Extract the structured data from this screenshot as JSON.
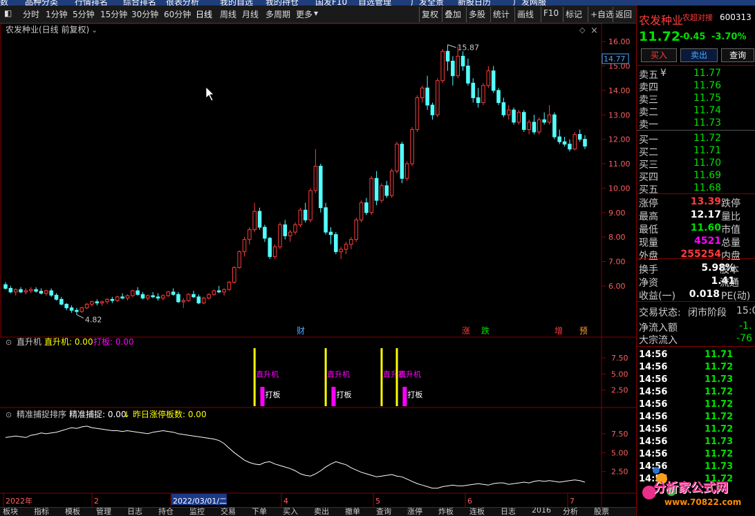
{
  "top_menu": [
    "数",
    "品种分类",
    "行情排名",
    "综合排名",
    "很表分析",
    "我的自选",
    "我的持仓",
    "国发F10",
    "自选管理",
    "广发全景",
    "新股日历",
    "广发网服"
  ],
  "toolbar": {
    "items": [
      "分时",
      "1分钟",
      "5分钟",
      "15分钟",
      "30分钟",
      "60分钟",
      "日线",
      "周线",
      "月线",
      "多周期",
      "更多"
    ],
    "active": "日线",
    "right_items": [
      "复权",
      "叠加",
      "多股",
      "统计",
      "画线",
      "F10",
      "标记",
      "+自选",
      "返回"
    ]
  },
  "main_chart": {
    "title": "农发种业(日线 前复权)",
    "y_ticks": [
      "16.00",
      "15.00",
      "14.00",
      "13.00",
      "12.00",
      "11.00",
      "10.00",
      "9.00",
      "8.00",
      "7.00",
      "6.00"
    ],
    "cursor_price": "14.77",
    "high_label": "15.87",
    "low_label": "4.82",
    "markers": [
      {
        "text": "财",
        "color": "#4aa8ff"
      },
      {
        "text": "涨",
        "color": "#ff3c3c"
      },
      {
        "text": "跌",
        "color": "#00e000"
      },
      {
        "text": "增",
        "color": "#ff3c3c"
      },
      {
        "text": "预",
        "color": "#ff9a3c"
      }
    ]
  },
  "indicator1": {
    "name": "直升机",
    "legend_a": "直升机: 0.00",
    "legend_b": "打板: 0.00",
    "y_ticks": [
      "7.50",
      "5.00",
      "2.50"
    ],
    "signal_a": "直升机",
    "signal_b": "打板"
  },
  "indicator2": {
    "name": "精准捕捉排序",
    "legend_a": "精准捕捉: 0.00",
    "arrow": "↓",
    "legend_b": "昨日涨停板数: 0.00",
    "y_ticks": [
      "7.50",
      "5.00",
      "2.50"
    ]
  },
  "time_axis": {
    "labels": [
      "2022年",
      "2",
      "2022/03/01/二",
      "4",
      "5",
      "6",
      "7"
    ]
  },
  "bottom_bar": [
    "板块",
    "指标",
    "模板",
    "管理",
    "日志",
    "持仓",
    "监控",
    "交易",
    "下单",
    "买入",
    "卖出",
    "撤单",
    "查询",
    "涨停",
    "炸板",
    "连板",
    "日志",
    "2016",
    "分析",
    "股票"
  ],
  "right_panel": {
    "stock_name": "农发种业",
    "super_label": "农超对接",
    "code": "600313",
    "price": "11.72",
    "change": "-0.45",
    "pct": "-3.70%",
    "buttons": {
      "buy": "买入",
      "sell": "卖出",
      "query": "查询"
    },
    "asks": [
      {
        "label": "卖五",
        "price": "11.77"
      },
      {
        "label": "卖四",
        "price": "11.76"
      },
      {
        "label": "卖三",
        "price": "11.75"
      },
      {
        "label": "卖二",
        "price": "11.74"
      },
      {
        "label": "卖一",
        "price": "11.73"
      }
    ],
    "ask5_mark": "¥",
    "bids": [
      {
        "label": "买一",
        "price": "11.72"
      },
      {
        "label": "买二",
        "price": "11.71"
      },
      {
        "label": "买三",
        "price": "11.70"
      },
      {
        "label": "买四",
        "price": "11.69"
      },
      {
        "label": "买五",
        "price": "11.68"
      }
    ],
    "stats": [
      {
        "label": "涨停",
        "value": "13.39",
        "color": "red",
        "label2": "跌停"
      },
      {
        "label": "最高",
        "value": "12.17",
        "color": "white",
        "label2": "量比"
      },
      {
        "label": "最低",
        "value": "11.60",
        "color": "green",
        "label2": "市值"
      },
      {
        "label": "现量",
        "value": "4521",
        "color": "mag",
        "label2": "总量"
      },
      {
        "label": "外盘",
        "value": "255254",
        "color": "red",
        "label2": "内盘"
      }
    ],
    "stats2": [
      {
        "label": "换手",
        "value": "5.98%",
        "label2": "股本"
      },
      {
        "label": "净资",
        "value": "1.41",
        "label2": "流通"
      },
      {
        "label": "收益(一)",
        "value": "0.018",
        "label2": "PE(动)"
      }
    ],
    "trade_status_label": "交易状态:",
    "trade_status": "闭市阶段",
    "trade_time": "15:0",
    "net_inflow_label": "净流入额",
    "net_inflow": "-1.",
    "block_inflow_label": "大宗流入",
    "block_inflow": "-76",
    "ticks": [
      {
        "time": "14:56",
        "price": "11.71"
      },
      {
        "time": "14:56",
        "price": "11.72"
      },
      {
        "time": "14:56",
        "price": "11.73"
      },
      {
        "time": "14:56",
        "price": "11.72"
      },
      {
        "time": "14:56",
        "price": "11.72"
      },
      {
        "time": "14:56",
        "price": "11.72"
      },
      {
        "time": "14:56",
        "price": "11.72"
      },
      {
        "time": "14:56",
        "price": "11.73"
      },
      {
        "time": "14:56",
        "price": "11.72"
      },
      {
        "time": "14:56",
        "price": "11.73"
      },
      {
        "time": "14:56",
        "price": "11.72"
      }
    ],
    "watermark_main": "分析家公式网",
    "watermark_url": "www.70822.com"
  },
  "chart_data": {
    "type": "candlestick",
    "title": "农发种业(日线 前复权)",
    "ylim": [
      4.3,
      16.4
    ],
    "candles": [
      [
        6.05,
        6.15,
        5.85,
        5.9
      ],
      [
        5.9,
        6.0,
        5.7,
        5.75
      ],
      [
        5.75,
        5.9,
        5.6,
        5.85
      ],
      [
        5.85,
        5.95,
        5.7,
        5.75
      ],
      [
        5.75,
        5.9,
        5.65,
        5.8
      ],
      [
        5.8,
        5.95,
        5.7,
        5.85
      ],
      [
        5.85,
        5.95,
        5.72,
        5.78
      ],
      [
        5.78,
        5.9,
        5.65,
        5.7
      ],
      [
        5.7,
        5.85,
        5.6,
        5.8
      ],
      [
        5.8,
        5.9,
        5.55,
        5.62
      ],
      [
        5.62,
        5.7,
        5.4,
        5.45
      ],
      [
        5.45,
        5.55,
        5.2,
        5.25
      ],
      [
        5.25,
        5.3,
        5.0,
        5.1
      ],
      [
        5.1,
        5.2,
        4.9,
        5.0
      ],
      [
        5.0,
        5.1,
        4.82,
        4.95
      ],
      [
        4.95,
        5.15,
        4.9,
        5.1
      ],
      [
        5.1,
        5.3,
        5.05,
        5.25
      ],
      [
        5.25,
        5.4,
        5.15,
        5.35
      ],
      [
        5.35,
        5.45,
        5.2,
        5.3
      ],
      [
        5.3,
        5.4,
        5.18,
        5.35
      ],
      [
        5.35,
        5.5,
        5.25,
        5.45
      ],
      [
        5.45,
        5.55,
        5.3,
        5.4
      ],
      [
        5.4,
        5.6,
        5.35,
        5.55
      ],
      [
        5.55,
        5.7,
        5.45,
        5.5
      ],
      [
        5.5,
        5.65,
        5.4,
        5.6
      ],
      [
        5.6,
        5.85,
        5.55,
        5.8
      ],
      [
        5.8,
        5.95,
        5.6,
        5.65
      ],
      [
        5.65,
        5.75,
        5.45,
        5.5
      ],
      [
        5.5,
        5.65,
        5.4,
        5.6
      ],
      [
        5.6,
        5.75,
        5.5,
        5.55
      ],
      [
        5.55,
        5.7,
        5.4,
        5.5
      ],
      [
        5.5,
        5.65,
        5.4,
        5.6
      ],
      [
        5.6,
        5.8,
        5.55,
        5.75
      ],
      [
        5.75,
        5.9,
        5.6,
        5.65
      ],
      [
        5.65,
        5.75,
        5.3,
        5.35
      ],
      [
        5.35,
        5.5,
        5.1,
        5.4
      ],
      [
        5.4,
        5.7,
        5.35,
        5.65
      ],
      [
        5.65,
        5.8,
        5.5,
        5.55
      ],
      [
        5.55,
        5.65,
        5.25,
        5.3
      ],
      [
        5.3,
        5.55,
        5.25,
        5.5
      ],
      [
        5.5,
        5.7,
        5.45,
        5.65
      ],
      [
        5.65,
        5.85,
        5.6,
        5.8
      ],
      [
        5.8,
        6.0,
        5.7,
        5.75
      ],
      [
        5.75,
        5.9,
        5.6,
        5.85
      ],
      [
        5.85,
        6.2,
        5.8,
        6.15
      ],
      [
        6.15,
        6.8,
        6.1,
        6.75
      ],
      [
        6.75,
        7.45,
        6.7,
        7.4
      ],
      [
        7.4,
        8.0,
        7.2,
        7.9
      ],
      [
        7.9,
        8.4,
        7.7,
        8.3
      ],
      [
        8.3,
        9.4,
        8.2,
        9.05
      ],
      [
        9.05,
        9.2,
        8.3,
        8.4
      ],
      [
        8.4,
        8.5,
        7.8,
        7.95
      ],
      [
        7.95,
        8.0,
        7.1,
        7.2
      ],
      [
        7.2,
        7.7,
        7.1,
        7.6
      ],
      [
        7.6,
        8.6,
        7.5,
        8.5
      ],
      [
        8.5,
        8.7,
        7.9,
        8.05
      ],
      [
        8.05,
        8.3,
        7.8,
        8.2
      ],
      [
        8.2,
        8.6,
        8.1,
        8.5
      ],
      [
        8.5,
        9.2,
        8.4,
        9.1
      ],
      [
        9.1,
        9.4,
        8.6,
        8.7
      ],
      [
        8.7,
        10.0,
        8.6,
        9.9
      ],
      [
        9.9,
        11.6,
        9.8,
        10.9
      ],
      [
        10.9,
        11.0,
        9.0,
        9.2
      ],
      [
        9.2,
        9.4,
        8.1,
        8.2
      ],
      [
        8.2,
        8.4,
        7.7,
        8.1
      ],
      [
        8.1,
        8.2,
        7.3,
        7.4
      ],
      [
        7.4,
        7.6,
        7.1,
        7.5
      ],
      [
        7.5,
        7.8,
        7.3,
        7.7
      ],
      [
        7.7,
        8.0,
        7.5,
        7.9
      ],
      [
        7.9,
        8.8,
        7.8,
        8.7
      ],
      [
        8.7,
        9.5,
        8.6,
        9.4
      ],
      [
        9.4,
        9.6,
        8.9,
        9.0
      ],
      [
        9.0,
        10.5,
        8.9,
        10.4
      ],
      [
        10.4,
        10.7,
        9.3,
        9.5
      ],
      [
        9.5,
        10.2,
        9.4,
        10.1
      ],
      [
        10.1,
        10.3,
        9.6,
        9.7
      ],
      [
        9.7,
        10.8,
        9.6,
        10.7
      ],
      [
        10.7,
        11.9,
        10.6,
        11.8
      ],
      [
        11.8,
        11.9,
        10.2,
        10.4
      ],
      [
        10.4,
        11.1,
        10.3,
        11.0
      ],
      [
        11.0,
        12.5,
        10.9,
        12.4
      ],
      [
        12.4,
        13.8,
        12.3,
        13.7
      ],
      [
        13.7,
        14.2,
        13.5,
        14.1
      ],
      [
        14.1,
        14.6,
        13.2,
        13.4
      ],
      [
        13.4,
        13.5,
        12.8,
        13.0
      ],
      [
        13.0,
        14.5,
        12.9,
        14.4
      ],
      [
        14.4,
        15.7,
        14.3,
        15.6
      ],
      [
        15.6,
        15.87,
        14.8,
        15.2
      ],
      [
        15.2,
        15.4,
        14.2,
        14.6
      ],
      [
        14.6,
        15.8,
        14.5,
        15.4
      ],
      [
        15.4,
        15.6,
        14.8,
        15.0
      ],
      [
        15.0,
        15.3,
        14.2,
        14.3
      ],
      [
        14.3,
        14.5,
        13.5,
        13.7
      ],
      [
        13.7,
        14.1,
        13.3,
        13.5
      ],
      [
        13.5,
        14.3,
        13.4,
        14.2
      ],
      [
        14.2,
        15.0,
        14.1,
        14.8
      ],
      [
        14.8,
        15.0,
        13.9,
        14.0
      ],
      [
        14.0,
        14.1,
        13.4,
        13.5
      ],
      [
        13.5,
        13.7,
        12.9,
        13.0
      ],
      [
        13.0,
        13.4,
        12.8,
        13.2
      ],
      [
        13.2,
        13.3,
        12.6,
        12.7
      ],
      [
        12.7,
        13.2,
        12.6,
        13.1
      ],
      [
        13.1,
        13.2,
        12.3,
        12.4
      ],
      [
        12.4,
        12.8,
        12.2,
        12.7
      ],
      [
        12.7,
        13.0,
        12.2,
        12.3
      ],
      [
        12.3,
        12.9,
        12.2,
        12.8
      ],
      [
        12.8,
        13.1,
        12.6,
        12.7
      ],
      [
        12.7,
        13.4,
        12.6,
        13.0
      ],
      [
        13.0,
        13.1,
        12.0,
        12.1
      ],
      [
        12.1,
        12.4,
        11.8,
        11.9
      ],
      [
        11.9,
        12.1,
        11.7,
        11.8
      ],
      [
        11.8,
        12.0,
        11.5,
        11.6
      ],
      [
        11.6,
        12.3,
        11.55,
        12.2
      ],
      [
        12.2,
        12.4,
        11.9,
        12.0
      ],
      [
        12.0,
        12.17,
        11.6,
        11.72
      ]
    ],
    "signals_a_index": [
      49,
      63,
      74,
      77
    ],
    "signals_b_index": [
      50,
      64,
      78
    ],
    "indicator2_values": [
      7.0,
      7.1,
      7.2,
      7.1,
      7.0,
      7.3,
      7.4,
      7.6,
      7.5,
      7.6,
      7.7,
      7.9,
      8.1,
      8.3,
      8.2,
      8.4,
      8.5,
      8.3,
      8.2,
      8.1,
      8.0,
      7.9,
      7.9,
      7.8,
      7.9,
      7.8,
      7.7,
      7.6,
      7.5,
      7.7,
      7.8,
      7.9,
      7.8,
      7.7,
      7.5,
      7.4,
      7.3,
      7.2,
      7.1,
      7.0,
      6.9,
      6.8,
      6.6,
      6.2,
      5.6,
      5.0,
      4.5,
      4.0,
      3.7,
      3.5,
      3.4,
      3.7,
      3.8,
      3.5,
      3.3,
      3.1,
      2.9,
      2.6,
      2.2,
      2.0,
      1.9,
      2.2,
      2.6,
      3.1,
      3.5,
      3.8,
      3.6,
      3.4,
      3.0,
      2.7,
      2.4,
      2.2,
      2.0,
      1.8,
      1.9,
      2.0,
      2.1,
      1.9,
      1.8,
      1.5,
      1.2,
      0.9,
      0.7,
      0.5,
      0.3,
      0.3,
      0.5,
      0.6,
      0.7,
      0.6,
      0.6,
      0.7,
      0.8,
      0.9,
      0.8,
      0.7,
      0.9,
      1.0,
      1.0,
      0.8,
      0.9,
      1.0,
      1.1,
      1.0,
      1.2,
      1.3,
      1.2,
      1.3,
      1.2,
      1.1,
      1.2,
      1.3,
      1.4,
      1.3,
      1.1
    ]
  }
}
